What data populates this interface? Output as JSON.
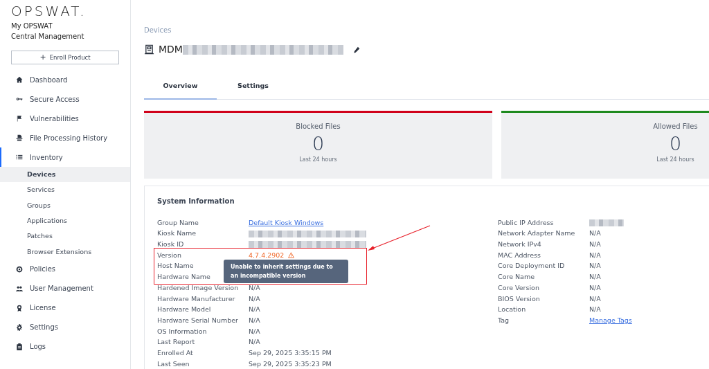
{
  "brand": {
    "logo": "OPSWAT.",
    "line1": "My OPSWAT",
    "line2": "Central Management"
  },
  "enroll_button": {
    "icon": "+",
    "label": "Enroll Product"
  },
  "nav": [
    {
      "label": "Dashboard",
      "selected": false
    },
    {
      "label": "Secure Access",
      "selected": false
    },
    {
      "label": "Vulnerabilities",
      "selected": false
    },
    {
      "label": "File Processing History",
      "selected": false
    },
    {
      "label": "Inventory",
      "selected": true,
      "expanded": true,
      "children": [
        {
          "label": "Devices",
          "selected": true
        },
        {
          "label": "Services",
          "selected": false
        },
        {
          "label": "Groups",
          "selected": false
        },
        {
          "label": "Applications",
          "selected": false
        },
        {
          "label": "Patches",
          "selected": false
        },
        {
          "label": "Browser Extensions",
          "selected": false
        }
      ]
    },
    {
      "label": "Policies",
      "selected": false
    },
    {
      "label": "User Management",
      "selected": false
    },
    {
      "label": "License",
      "selected": false
    },
    {
      "label": "Settings",
      "selected": false
    },
    {
      "label": "Logs",
      "selected": false
    }
  ],
  "breadcrumb": "Devices",
  "device_title": {
    "prefix": "MDM",
    "redacted": true
  },
  "tabs": [
    {
      "label": "Overview",
      "selected": true
    },
    {
      "label": "Settings",
      "selected": false
    }
  ],
  "stats": [
    {
      "title": "Blocked Files",
      "value": "0",
      "caption": "Last 24 hours",
      "color": "#d0021b"
    },
    {
      "title": "Allowed Files",
      "value": "0",
      "caption": "Last 24 hours",
      "color": "#1e8a1e"
    }
  ],
  "system_information": {
    "title": "System Information",
    "left": [
      {
        "label": "Group Name",
        "kind": "link",
        "value": "Default Kiosk Windows"
      },
      {
        "label": "Kiosk Name",
        "kind": "redacted"
      },
      {
        "label": "Kiosk ID",
        "kind": "redacted"
      },
      {
        "label": "Version",
        "kind": "warning",
        "value": "4.7.4.2902",
        "tooltip": "Unable to inherit settings due to an incompatible version"
      },
      {
        "label": "Host Name",
        "kind": "text"
      },
      {
        "label": "Hardware Name",
        "kind": "text"
      },
      {
        "label": "Hardened Image Version",
        "kind": "text",
        "value": "N/A"
      },
      {
        "label": "Hardware Manufacturer",
        "kind": "text",
        "value": "N/A"
      },
      {
        "label": "Hardware Model",
        "kind": "text",
        "value": "N/A"
      },
      {
        "label": "Hardware Serial Number",
        "kind": "text",
        "value": "N/A"
      },
      {
        "label": "OS Information",
        "kind": "text",
        "value": "N/A"
      },
      {
        "label": "Last Report",
        "kind": "text",
        "value": "N/A"
      },
      {
        "label": "Enrolled At",
        "kind": "text",
        "value": "Sep 29, 2025 3:35:15 PM"
      },
      {
        "label": "Last Seen",
        "kind": "text",
        "value": "Sep 29, 2025 3:35:23 PM"
      }
    ],
    "right": [
      {
        "label": "Public IP Address",
        "kind": "redacted"
      },
      {
        "label": "Network Adapter Name",
        "kind": "text",
        "value": "N/A"
      },
      {
        "label": "Network IPv4",
        "kind": "text",
        "value": "N/A"
      },
      {
        "label": "MAC Address",
        "kind": "text",
        "value": "N/A"
      },
      {
        "label": "Core Deployment ID",
        "kind": "text",
        "value": "N/A"
      },
      {
        "label": "Core Name",
        "kind": "text",
        "value": "N/A"
      },
      {
        "label": "Core Version",
        "kind": "text",
        "value": "N/A"
      },
      {
        "label": "BIOS Version",
        "kind": "text",
        "value": "N/A"
      },
      {
        "label": "Location",
        "kind": "text",
        "value": "N/A"
      },
      {
        "label": "Tag",
        "kind": "link",
        "value": "Manage Tags"
      }
    ]
  }
}
